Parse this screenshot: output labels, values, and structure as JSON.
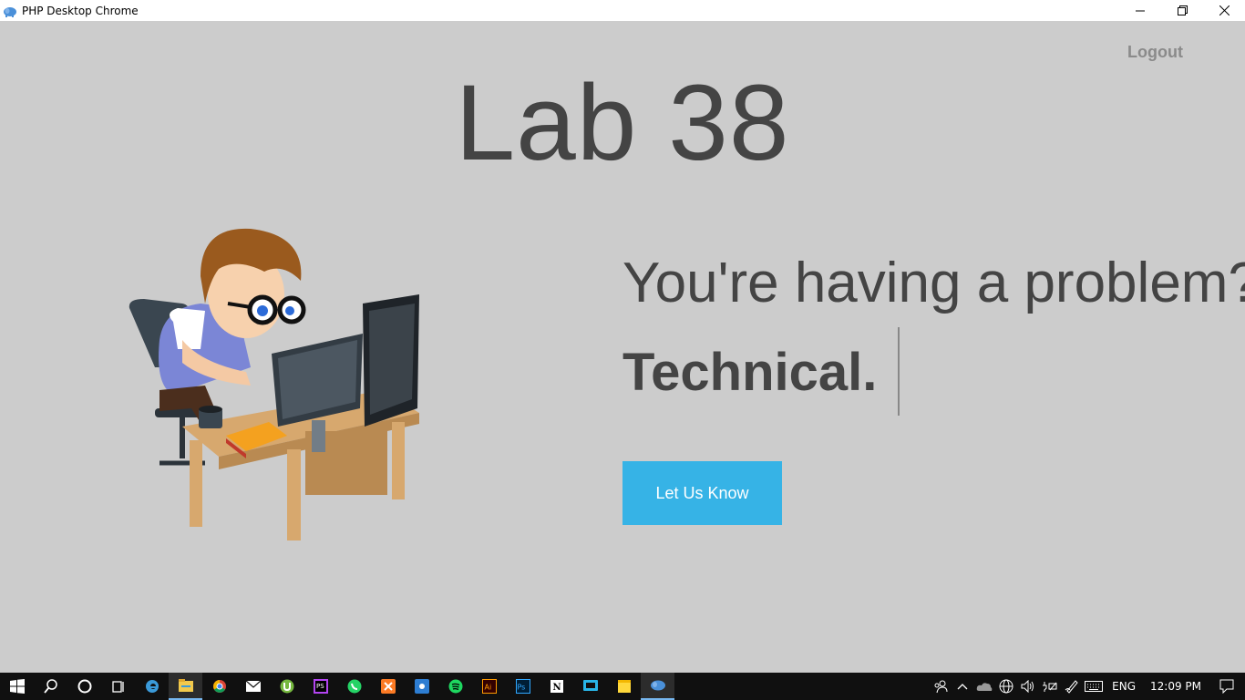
{
  "window": {
    "title": "PHP Desktop Chrome",
    "app_icon": "php-elephant-icon",
    "controls": [
      "minimize-icon",
      "restore-icon",
      "close-icon"
    ]
  },
  "page": {
    "logout_label": "Logout",
    "heading": "Lab 38",
    "problem_text": "You're having a problem?",
    "typed_text": "Technical.",
    "cta_label": "Let Us Know",
    "illustration": "developer-at-desk-illustration",
    "colors": {
      "background": "#cccccc",
      "text": "#444444",
      "cta": "#36b3e6",
      "logout": "#8a8a8a"
    }
  },
  "taskbar": {
    "apps": [
      "start-icon",
      "search-icon",
      "cortana-icon",
      "task-view-icon",
      "edge-icon",
      "file-explorer-icon",
      "chrome-icon",
      "mail-icon",
      "utorrent-icon",
      "phpstorm-icon",
      "whatsapp-icon",
      "xampp-icon",
      "app-icon",
      "spotify-icon",
      "illustrator-icon",
      "photoshop-icon",
      "notion-icon",
      "cast-icon",
      "sticky-notes-icon",
      "php-desktop-icon"
    ],
    "active_app": "php-desktop-icon",
    "tray": {
      "language": "ENG",
      "time": "12:09 PM",
      "icons": [
        "people-icon",
        "chevron-up-icon",
        "onedrive-icon",
        "network-icon",
        "volume-icon",
        "battery-icon",
        "pen-icon",
        "keyboard-icon",
        "notification-icon"
      ]
    }
  }
}
